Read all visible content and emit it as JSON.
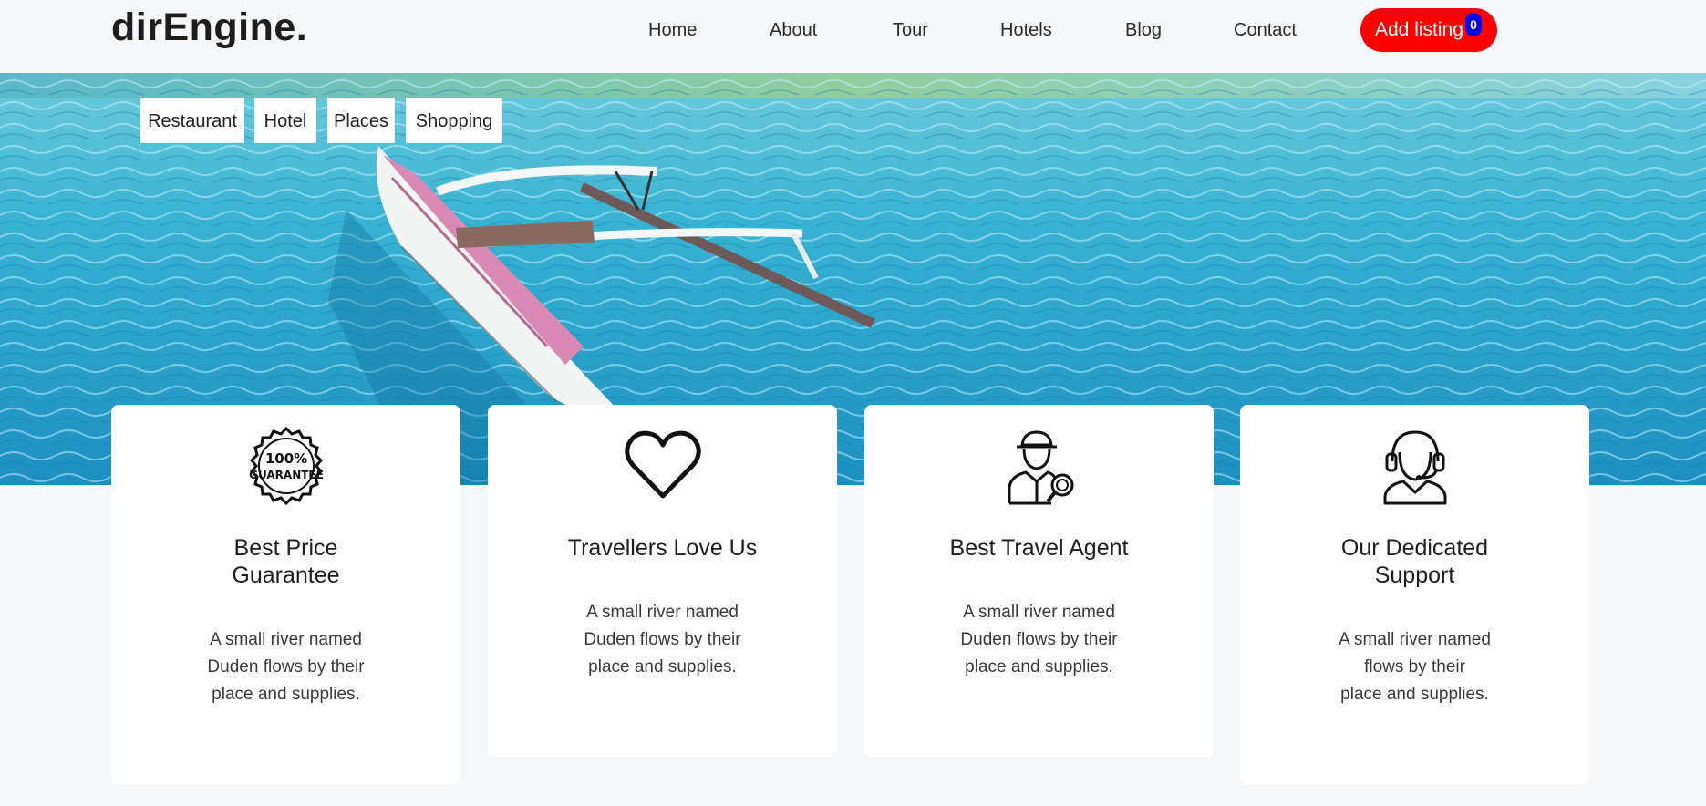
{
  "nav": {
    "brand": "dirEngine.",
    "links": [
      "Home",
      "About",
      "Tour",
      "Hotels",
      "Blog",
      "Contact"
    ],
    "add_listing": "Add listing",
    "badge_count": "0",
    "accent_color": "#ff0000",
    "badge_color": "#0000ee"
  },
  "categories": [
    "Restaurant",
    "Hotel",
    "Places",
    "Shopping"
  ],
  "features": [
    {
      "icon": "guarantee-badge-icon",
      "badge_text_1": "100%",
      "badge_text_2": "GUARANTEE",
      "title_line1": "Best Price",
      "title_line2": "Guarantee",
      "text_lines": [
        "A small river named",
        "Duden flows by their",
        "place and supplies."
      ]
    },
    {
      "icon": "heart-icon",
      "title_line1": "Travellers Love Us",
      "title_line2": "",
      "text_lines": [
        "A small river named",
        "Duden flows by their",
        "place and supplies."
      ]
    },
    {
      "icon": "travel-agent-icon",
      "title_line1": "Best Travel Agent",
      "title_line2": "",
      "text_lines": [
        "A small river named",
        "Duden flows by their",
        "place and supplies."
      ]
    },
    {
      "icon": "support-headset-icon",
      "title_line1": "Our Dedicated",
      "title_line2": "Support",
      "text_lines": [
        "A small river named",
        "flows by their",
        "place and supplies."
      ]
    }
  ]
}
